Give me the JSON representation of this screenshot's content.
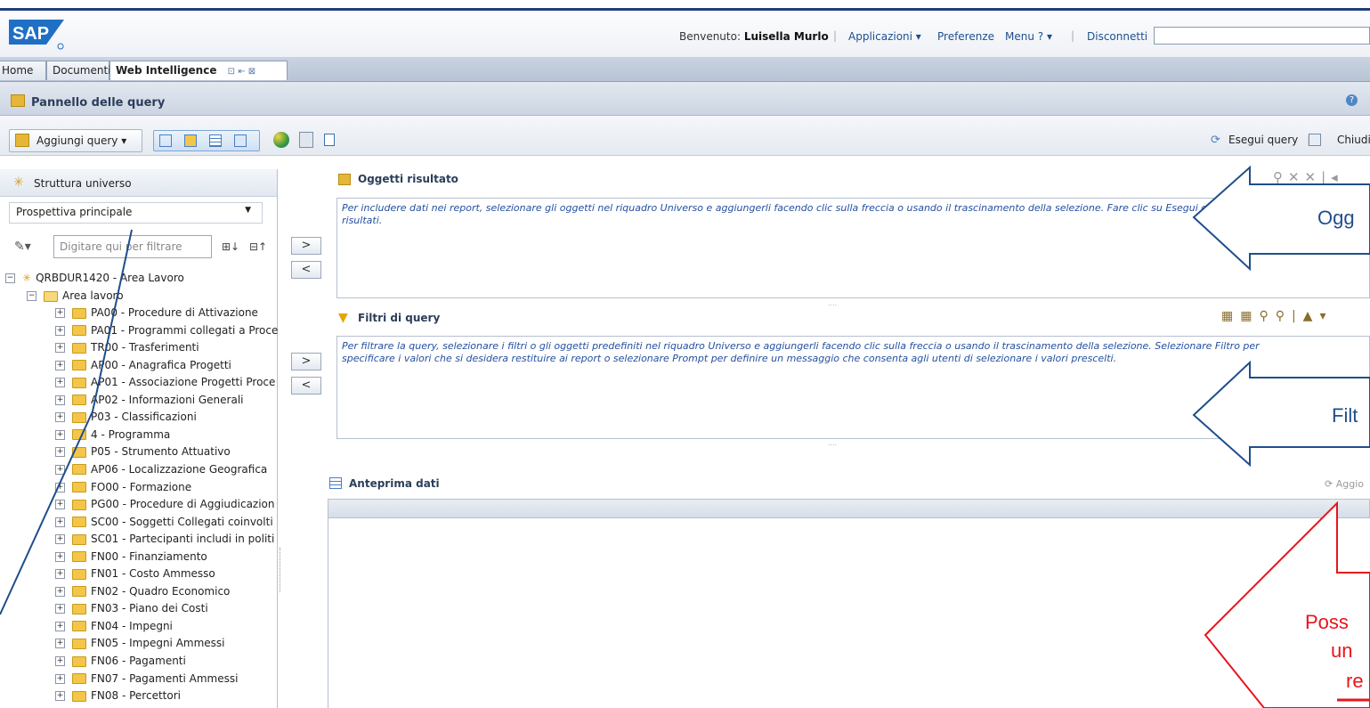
{
  "header": {
    "logo_text": "SAP",
    "welcome_label": "Benvenuto:",
    "user_name": "Luisella Murlo",
    "links": [
      "Applicazioni",
      "Preferenze",
      "Menu ?",
      "Disconnetti"
    ]
  },
  "tabs": [
    {
      "label": "Home"
    },
    {
      "label": "Documenti"
    },
    {
      "label": "Web Intelligence"
    }
  ],
  "query_panel": {
    "title": "Pannello delle query"
  },
  "toolbar": {
    "add_query_label": "Aggiungi query",
    "run_query_label": "Esegui query",
    "close_label": "Chiudi"
  },
  "left_panel": {
    "title": "Struttura universo",
    "perspective": "Prospettiva principale",
    "filter_placeholder": "Digitare qui per filtrare",
    "root": "QRBDUR1420 - Area Lavoro",
    "folder": "Area lavoro",
    "items": [
      "PA00 - Procedure di Attivazione",
      "PA01 - Programmi collegati a Proce",
      "TR00 - Trasferimenti",
      "AP00 - Anagrafica Progetti",
      "AP01 - Associazione Progetti Proce",
      "AP02 - Informazioni Generali",
      "P03 - Classificazioni",
      "4 - Programma",
      "P05 - Strumento Attuativo",
      "AP06 - Localizzazione Geografica",
      "FO00 - Formazione",
      "PG00 - Procedure di Aggiudicazion",
      "SC00 - Soggetti Collegati coinvolti",
      "SC01 - Partecipanti includi in politi",
      "FN00 - Finanziamento",
      "FN01 - Costo Ammesso",
      "FN02 - Quadro Economico",
      "FN03 - Piano dei Costi",
      "FN04 - Impegni",
      "FN05 - Impegni Ammessi",
      "FN06 - Pagamenti",
      "FN07 - Pagamenti Ammessi",
      "FN08 - Percettori"
    ]
  },
  "arrows": {
    "add": ">",
    "remove": "<"
  },
  "result_objects": {
    "title": "Oggetti risultato",
    "hint": "Per includere dati nei report, selezionare gli oggetti nel riquadro Universo e aggiungerli facendo clic sulla freccia o usando il trascinamento della selezione. Fare clic su Esegui query per restituire",
    "hint2": "risultati."
  },
  "query_filters": {
    "title": "Filtri di query",
    "hint": "Per filtrare la query, selezionare i filtri o gli oggetti predefiniti nel riquadro Universo e aggiungerli facendo clic sulla freccia o usando il trascinamento della selezione. Selezionare Filtro per",
    "hint2": "specificare i valori che si desidera restituire ai report o selezionare Prompt per definire un messaggio che consenta agli utenti di selezionare i valori prescelti."
  },
  "data_preview": {
    "title": "Anteprima dati",
    "refresh_label": "Aggio"
  },
  "callouts": {
    "blue1": "Ogg",
    "blue2": "Filt",
    "red": [
      "Poss",
      "un",
      "re"
    ]
  },
  "colors": {
    "callout_blue": "#1f4e8c",
    "callout_red": "#e8141c",
    "link": "#1d4f91"
  }
}
